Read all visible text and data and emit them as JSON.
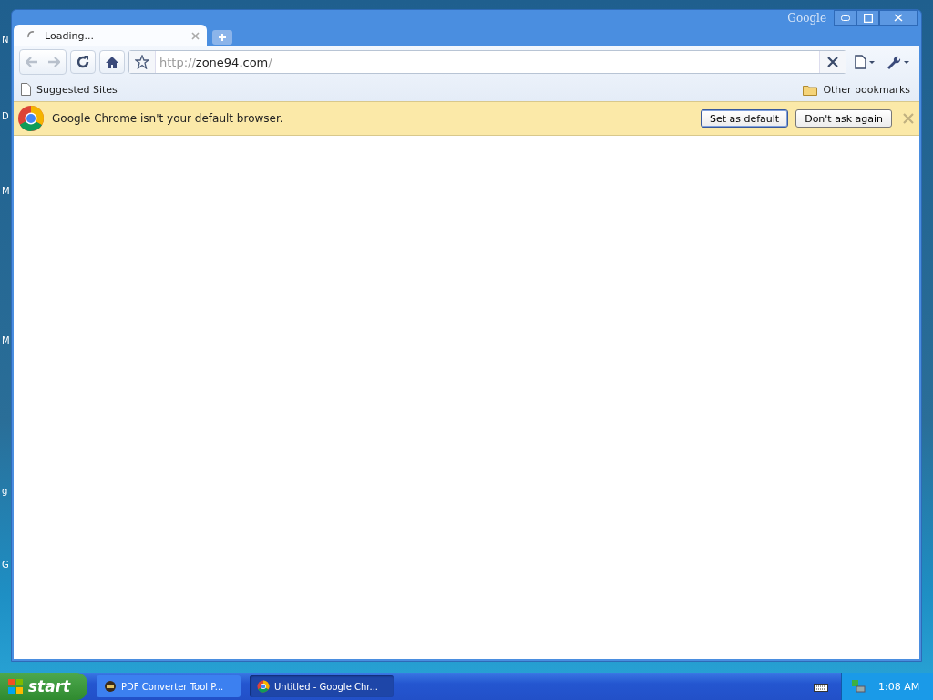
{
  "desktop_labels": [
    "N",
    "D",
    "M",
    "M",
    "g",
    "G"
  ],
  "window": {
    "brand": "Google"
  },
  "tabs": [
    {
      "title": "Loading...",
      "selected": true,
      "loading": true
    }
  ],
  "toolbar": {
    "url_scheme": "http://",
    "url_host": "zone94.com",
    "url_tail": "/",
    "starred": false
  },
  "bookmarks": {
    "items": [
      {
        "label": "Suggested Sites"
      }
    ],
    "other": "Other bookmarks"
  },
  "infobar": {
    "message": "Google Chrome isn't your default browser.",
    "buttons": [
      {
        "label": "Set as default",
        "selected": true
      },
      {
        "label": "Don't ask again",
        "selected": false
      }
    ]
  },
  "taskbar": {
    "start": "start",
    "items": [
      {
        "label": "PDF Converter Tool P...",
        "kind": "pdf",
        "selected": false
      },
      {
        "label": "Untitled - Google Chr...",
        "kind": "chrome",
        "selected": true
      }
    ],
    "clock": "1:08 AM"
  }
}
